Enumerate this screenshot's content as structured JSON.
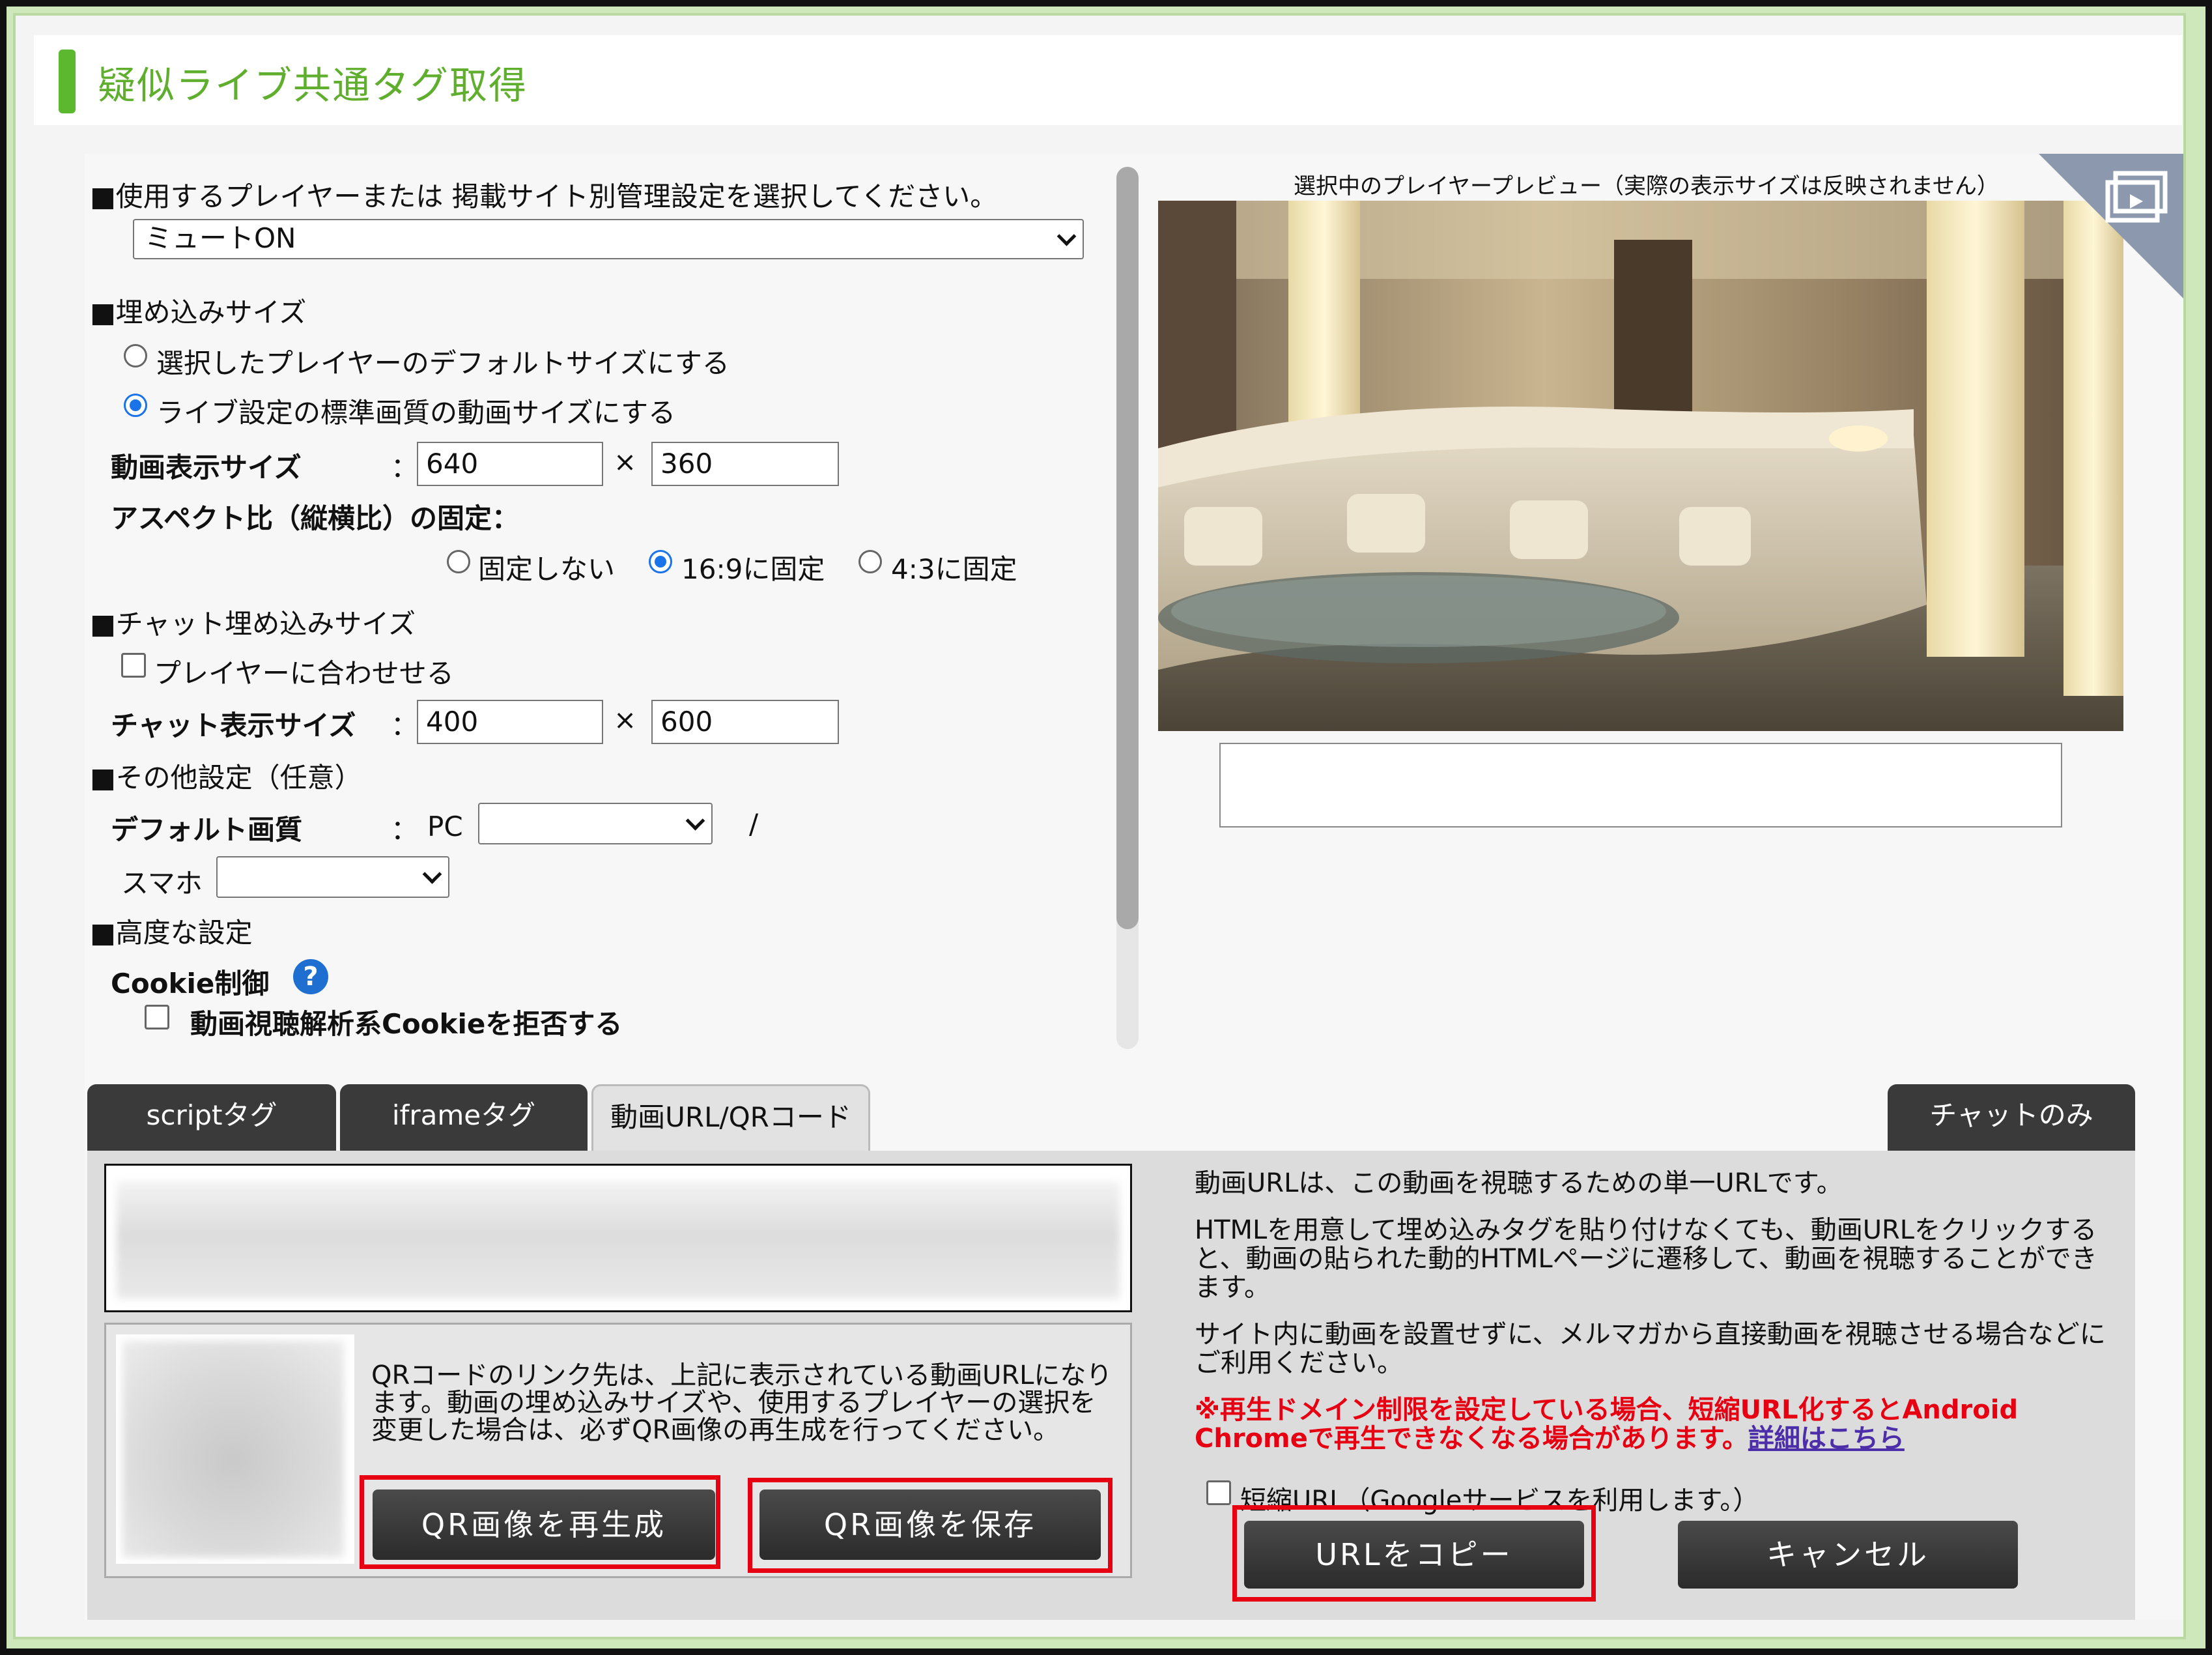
{
  "page_title": "疑似ライブ共通タグ取得",
  "player_section": {
    "label": "■使用するプレイヤーまたは 掲載サイト別管理設定を選択してください。",
    "selected": "ミュートON"
  },
  "embed_size": {
    "label": "■埋め込みサイズ",
    "option_default": "選択したプレイヤーのデフォルトサイズにする",
    "option_standard": "ライブ設定の標準画質の動画サイズにする",
    "selected": "option_standard",
    "video_size_label": "動画表示サイズ",
    "colon": "：",
    "times": "×",
    "width": "640",
    "height": "360",
    "aspect_label": "アスペクト比（縦横比）の固定：",
    "aspect_options": [
      "固定しない",
      "16:9に固定",
      "4:3に固定"
    ],
    "aspect_selected": "16:9に固定"
  },
  "chat_size": {
    "label": "■チャット埋め込みサイズ",
    "fit_player": "プレイヤーに合わせせる",
    "chat_size_label": "チャット表示サイズ",
    "width": "400",
    "height": "600"
  },
  "other": {
    "label": "■その他設定（任意）",
    "default_quality_label": "デフォルト画質",
    "pc_label": "PC",
    "slash": "/",
    "sp_label": "スマホ",
    "pc_value": "",
    "sp_value": ""
  },
  "advanced": {
    "label": "■高度な設定",
    "cookie_label": "Cookie制御",
    "help_glyph": "?",
    "cookie_option": "動画視聴解析系Cookieを拒否する"
  },
  "preview": {
    "caption": "選択中のプレイヤープレビュー（実際の表示サイズは反映されません）"
  },
  "tabs": {
    "script": "scriptタグ",
    "iframe": "iframeタグ",
    "url_qr": "動画URL/QRコード",
    "chat_only": "チャットのみ",
    "active": "url_qr"
  },
  "qr": {
    "description": "QRコードのリンク先は、上記に表示されている動画URLになります。動画の埋め込みサイズや、使用するプレイヤーの選択を変更した場合は、必ずQR画像の再生成を行ってください。",
    "regenerate": "QR画像を再生成",
    "save": "QR画像を保存"
  },
  "url_info": {
    "p1": "動画URLは、この動画を視聴するための単一URLです。",
    "p2": "HTMLを用意して埋め込みタグを貼り付けなくても、動画URLをクリックすると、動画の貼られた動的HTMLページに遷移して、動画を視聴することができます。",
    "p3": "サイト内に動画を設置せずに、メルマガから直接動画を視聴させる場合などにご利用ください。",
    "warning": "※再生ドメイン制限を設定している場合、短縮URL化するとAndroid Chromeで再生できなくなる場合があります。",
    "detail_link": "詳細はこちら",
    "shorten_label": "短縮URL（Googleサービスを利用します。）",
    "copy_button": "URLをコピー",
    "cancel_button": "キャンセル"
  },
  "colors": {
    "accent_green": "#5cb82e",
    "highlight_red": "#e60012",
    "button_dark": "#3a3a3a"
  }
}
